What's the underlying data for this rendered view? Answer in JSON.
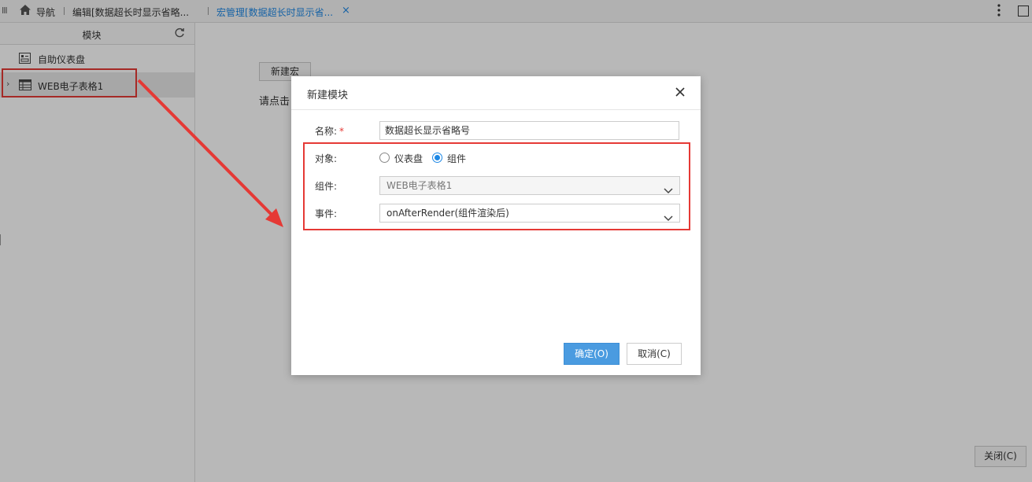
{
  "topbar": {
    "nav_label": "导航",
    "tab_edit": "编辑[数据超长时显示省略...",
    "tab_macro": "宏管理[数据超长时显示省...",
    "tab_close_glyph": "×",
    "menu_glyph": "III",
    "icons": [
      "menu-icon",
      "home-icon",
      "more-vertical-icon",
      "maximize-icon"
    ]
  },
  "left_panel": {
    "header_title": "模块",
    "items": [
      {
        "label": "自助仪表盘",
        "icon": "dashboard-icon"
      },
      {
        "label": "WEB电子表格1",
        "icon": "spreadsheet-icon",
        "caret": "›"
      }
    ]
  },
  "main": {
    "new_macro_label": "新建宏",
    "hint_text": "请点击",
    "close_label": "关闭(C)"
  },
  "dialog": {
    "title": "新建模块",
    "name_label": "名称:",
    "required_mark": "*",
    "name_value": "数据超长显示省略号",
    "object_label": "对象:",
    "object_options": [
      {
        "label": "仪表盘",
        "checked": false
      },
      {
        "label": "组件",
        "checked": true
      }
    ],
    "component_label": "组件:",
    "component_value": "WEB电子表格1",
    "event_label": "事件:",
    "event_value": "onAfterRender(组件渲染后)",
    "ok_label": "确定(O)",
    "cancel_label": "取消(C)"
  },
  "colors": {
    "accent": "#1e88e5",
    "highlight": "#e53935",
    "primary_button": "#4a9be0"
  }
}
